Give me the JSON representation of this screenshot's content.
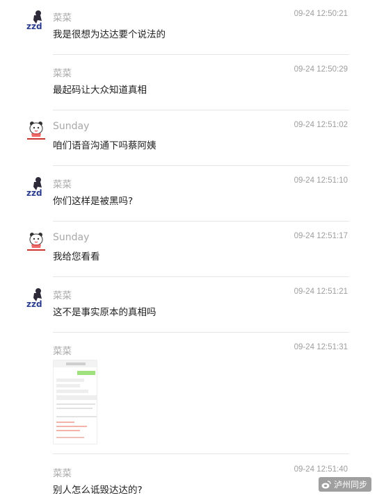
{
  "messages": [
    {
      "sender": "菜菜",
      "time": "09-24 12:50:21",
      "text": "我是很想为达达要个说法的",
      "avatar": "zzd"
    },
    {
      "sender": "菜菜",
      "time": "09-24 12:50:29",
      "text": "最起码让大众知道真相",
      "avatar": ""
    },
    {
      "sender": "Sunday",
      "time": "09-24 12:51:02",
      "text": "咱们语音沟通下吗蔡阿姨",
      "avatar": "bear"
    },
    {
      "sender": "菜菜",
      "time": "09-24 12:51:10",
      "text": "你们这样是被黑吗?",
      "avatar": "zzd"
    },
    {
      "sender": "Sunday",
      "time": "09-24 12:51:17",
      "text": "我给您看看",
      "avatar": "bear"
    },
    {
      "sender": "菜菜",
      "time": "09-24 12:51:21",
      "text": "这不是事实原本的真相吗",
      "avatar": "zzd"
    },
    {
      "sender": "菜菜",
      "time": "09-24 12:51:31",
      "text": "",
      "avatar": "",
      "image": "chat-screenshot-thumbnail"
    },
    {
      "sender": "菜菜",
      "time": "09-24 12:51:40",
      "text": "别人怎么诋毁达达的?",
      "avatar": ""
    }
  ],
  "avatar_zzd_text": "zzd",
  "watermark": "泸州同步",
  "colors": {
    "sender": "#a8a8a8",
    "time": "#9d9d9d",
    "text": "#222222",
    "divider": "#e6e6e6"
  }
}
